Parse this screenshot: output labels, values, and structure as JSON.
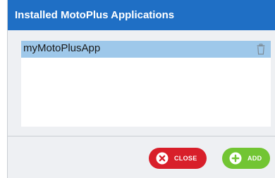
{
  "dialog": {
    "title": "Installed MotoPlus Applications"
  },
  "list": {
    "items": [
      {
        "label": "myMotoPlusApp",
        "selected": true,
        "action_icon": "trash-icon"
      }
    ]
  },
  "footer": {
    "close_label": "CLOSE",
    "add_label": "ADD"
  },
  "colors": {
    "title_bar": "#1f6fc5",
    "selected_row": "#9ec8ea",
    "close_button": "#d81f2a",
    "add_button": "#72c533"
  }
}
